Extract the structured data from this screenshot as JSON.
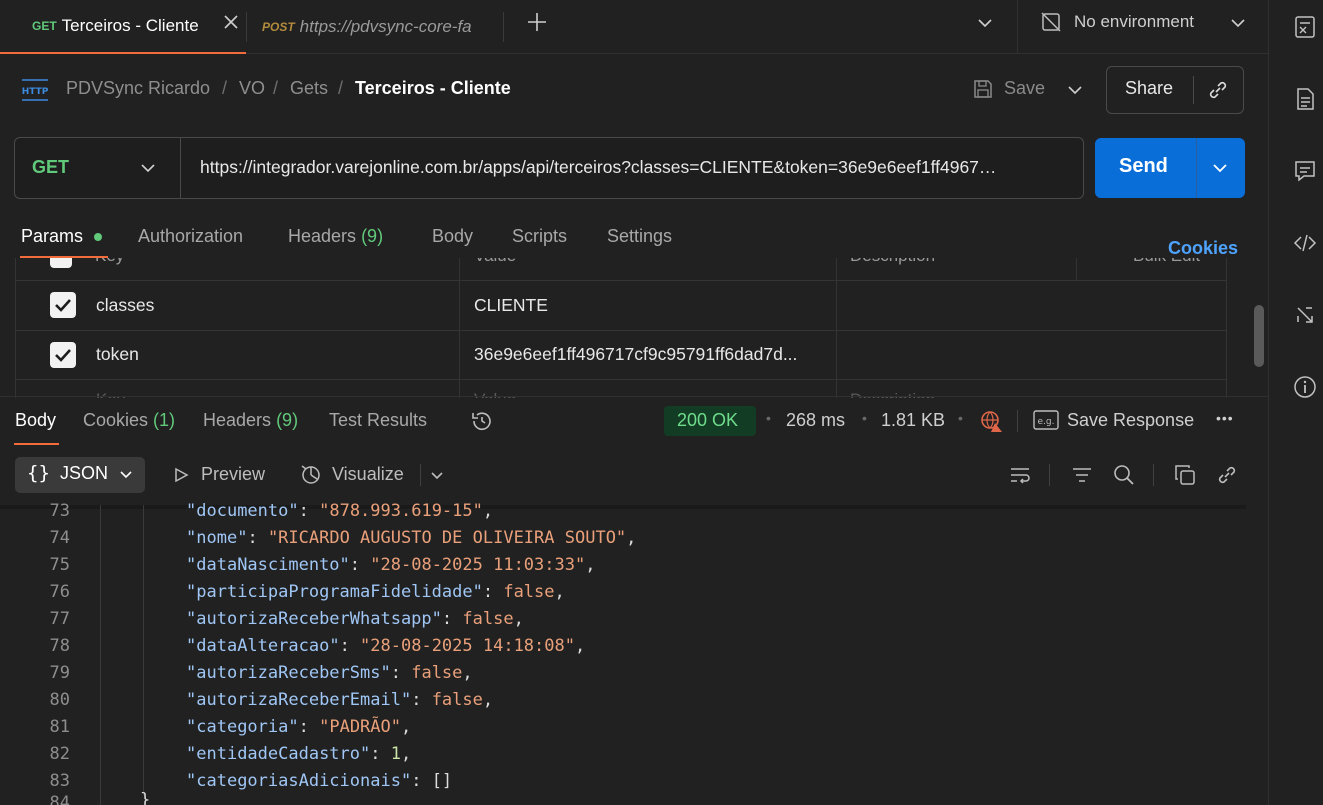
{
  "tabs": [
    {
      "method": "GET",
      "title": "Terceiros - Cliente"
    },
    {
      "method": "POST",
      "title": "https://pdvsync-core-fa"
    }
  ],
  "environment": {
    "label": "No environment"
  },
  "breadcrumb": {
    "items": [
      "PDVSync Ricardo",
      "VO",
      "Gets"
    ],
    "current": "Terceiros - Cliente",
    "separator": "/",
    "protocol_badge": "HTTP"
  },
  "toolbar": {
    "save_label": "Save",
    "share_label": "Share"
  },
  "request": {
    "method": "GET",
    "url": "https://integrador.varejonline.com.br/apps/api/terceiros?classes=CLIENTE&token=36e9e6eef1ff4967…",
    "send_label": "Send"
  },
  "request_tabs": {
    "params": "Params",
    "authorization": "Authorization",
    "headers": "Headers",
    "headers_count": "(9)",
    "body": "Body",
    "scripts": "Scripts",
    "settings": "Settings",
    "cookies_link": "Cookies"
  },
  "params": {
    "partial_headers": [
      "Key",
      "Value",
      "Description",
      "Bulk Edit"
    ],
    "rows": [
      {
        "key": "classes",
        "value": "CLIENTE",
        "checked": true
      },
      {
        "key": "token",
        "value": "36e9e6eef1ff496717cf9c95791ff6dad7d...",
        "checked": true
      }
    ],
    "placeholder_row": [
      "Key",
      "Value",
      "Description"
    ]
  },
  "response_tabs": {
    "body": "Body",
    "cookies": "Cookies",
    "cookies_count": "(1)",
    "headers": "Headers",
    "headers_count": "(9)",
    "test_results": "Test Results"
  },
  "response_meta": {
    "status": "200 OK",
    "time": "268 ms",
    "size": "1.81 KB",
    "save_response": "Save Response",
    "more": "•••"
  },
  "response_view": {
    "format": "JSON",
    "preview": "Preview",
    "visualize": "Visualize"
  },
  "code_lines": [
    {
      "n": "73",
      "key": "documento",
      "val": "\"878.993.619-15\"",
      "type": "s",
      "comma": true
    },
    {
      "n": "74",
      "key": "nome",
      "val": "\"RICARDO AUGUSTO DE OLIVEIRA SOUTO\"",
      "type": "s",
      "comma": true
    },
    {
      "n": "75",
      "key": "dataNascimento",
      "val": "\"28-08-2025 11:03:33\"",
      "type": "s",
      "comma": true
    },
    {
      "n": "76",
      "key": "participaProgramaFidelidade",
      "val": "false",
      "type": "b",
      "comma": true
    },
    {
      "n": "77",
      "key": "autorizaReceberWhatsapp",
      "val": "false",
      "type": "b",
      "comma": true
    },
    {
      "n": "78",
      "key": "dataAlteracao",
      "val": "\"28-08-2025 14:18:08\"",
      "type": "s",
      "comma": true
    },
    {
      "n": "79",
      "key": "autorizaReceberSms",
      "val": "false",
      "type": "b",
      "comma": true
    },
    {
      "n": "80",
      "key": "autorizaReceberEmail",
      "val": "false",
      "type": "b",
      "comma": true
    },
    {
      "n": "81",
      "key": "categoria",
      "val": "\"PADRÃO\"",
      "type": "s",
      "comma": true
    },
    {
      "n": "82",
      "key": "entidadeCadastro",
      "val": "1",
      "type": "n",
      "comma": true
    },
    {
      "n": "83",
      "key": "categoriasAdicionais",
      "val": "[]",
      "type": "p",
      "comma": false
    }
  ],
  "colors": {
    "accent_tab": "#f26b3a",
    "send_button": "#0a6ed8",
    "status_ok": "#6fdc8c",
    "get_method": "#61c97a",
    "cookies_link": "#4ea3ff"
  },
  "icons": {
    "no_env": "no-environment-icon",
    "save": "floppy-disk-icon",
    "link": "link-icon",
    "history": "history-icon",
    "globe": "globe-warning-icon",
    "wrap": "wrap-lines-icon",
    "filter": "filter-icon",
    "search": "search-icon",
    "copy": "copy-icon"
  }
}
